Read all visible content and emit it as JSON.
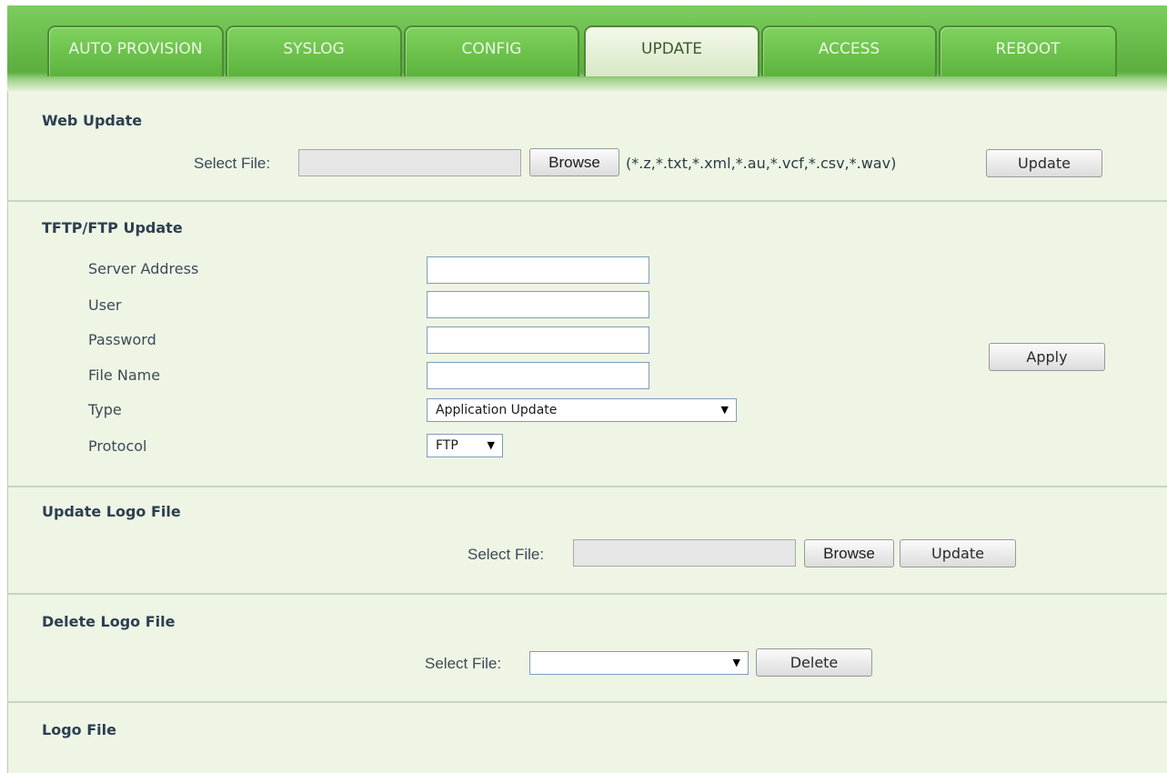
{
  "tabs": [
    {
      "label": "AUTO PROVISION",
      "active": false
    },
    {
      "label": "SYSLOG",
      "active": false
    },
    {
      "label": "CONFIG",
      "active": false
    },
    {
      "label": "UPDATE",
      "active": true
    },
    {
      "label": "ACCESS",
      "active": false
    },
    {
      "label": "REBOOT",
      "active": false
    }
  ],
  "web_update": {
    "title": "Web Update",
    "select_file_label": "Select File:",
    "file_value": "",
    "browse_label": "Browse",
    "extensions_hint": "(*.z,*.txt,*.xml,*.au,*.vcf,*.csv,*.wav)",
    "update_label": "Update"
  },
  "tftp": {
    "title": "TFTP/FTP Update",
    "server_address_label": "Server Address",
    "server_address_value": "",
    "user_label": "User",
    "user_value": "",
    "password_label": "Password",
    "password_value": "",
    "file_name_label": "File Name",
    "file_name_value": "",
    "type_label": "Type",
    "type_selected": "Application Update",
    "protocol_label": "Protocol",
    "protocol_selected": "FTP",
    "apply_label": "Apply"
  },
  "update_logo": {
    "title": "Update Logo File",
    "select_file_label": "Select File:",
    "file_value": "",
    "browse_label": "Browse",
    "update_label": "Update"
  },
  "delete_logo": {
    "title": "Delete Logo File",
    "select_file_label": "Select File:",
    "selected": "",
    "delete_label": "Delete"
  },
  "logo_file": {
    "title": "Logo File"
  },
  "colors": {
    "tab_green": "#5cb33c",
    "tab_active": "#e6f0d8",
    "panel_background": "#eef5e5",
    "heading_text": "#2c3f51"
  },
  "icons": {
    "dropdown_arrow": "▼"
  }
}
